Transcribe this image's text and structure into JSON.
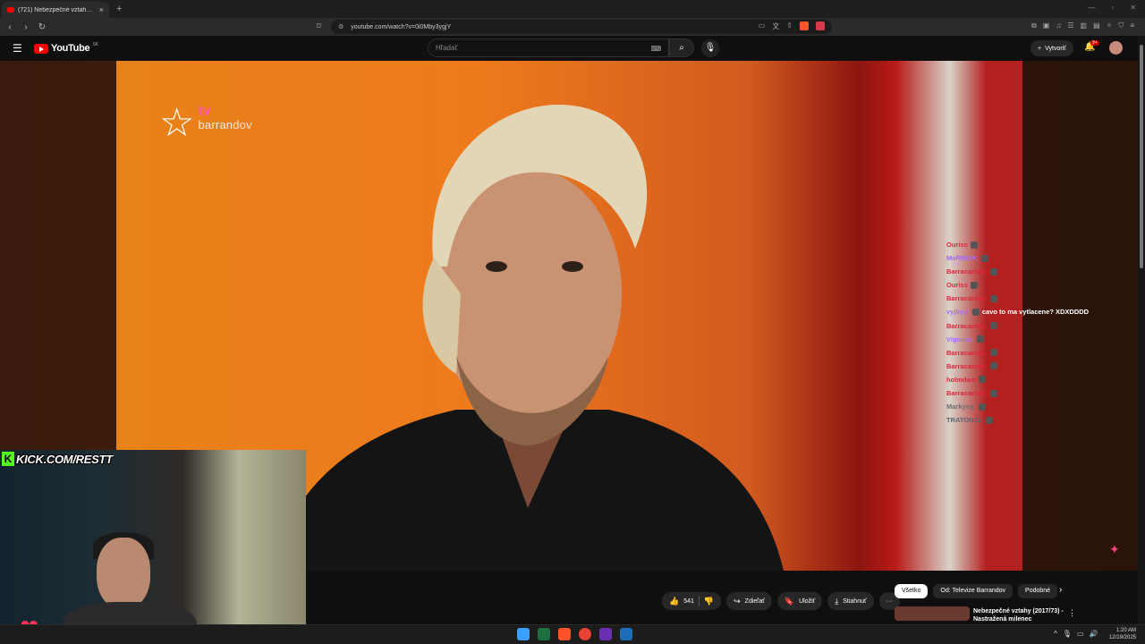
{
  "browser": {
    "tab_title": "(721) Nebezpečné vztahy (20",
    "tab_close": "×",
    "new_tab": "+",
    "url": "youtube.com/watch?v=0i0Mby3ygjY"
  },
  "youtube": {
    "logo_text": "YouTube",
    "country_code": "SK",
    "search_placeholder": "Hľadať",
    "create_label": "Vytvoriť",
    "notif_badge": "9+"
  },
  "video": {
    "channel_logo_tv": "tv",
    "channel_logo_brand": "barrandov",
    "overlay_url": "KICK.COM/RESTT"
  },
  "chat": [
    {
      "user": "Ouriss",
      "msg": "",
      "color": "#e0233a"
    },
    {
      "user": "MaRRIXX:",
      "msg": "",
      "color": "#a46bff"
    },
    {
      "user": "Barracanida:",
      "msg": "",
      "color": "#e0233a"
    },
    {
      "user": "Ouriss",
      "msg": "",
      "color": "#e0233a"
    },
    {
      "user": "Barracanida:",
      "msg": "",
      "color": "#e0233a"
    },
    {
      "user": "vyjbyy:",
      "msg": "cavo to ma vytlacene? XDXDDDD",
      "color": "#a46bff"
    },
    {
      "user": "Barracanida:",
      "msg": "",
      "color": "#e0233a"
    },
    {
      "user": "Vignnor:",
      "msg": "",
      "color": "#a46bff"
    },
    {
      "user": "Barracanida:",
      "msg": "",
      "color": "#e0233a"
    },
    {
      "user": "Barracanida:",
      "msg": "",
      "color": "#e0233a"
    },
    {
      "user": "holmdam",
      "msg": "",
      "color": "#e0233a"
    },
    {
      "user": "Barracanida:",
      "msg": "",
      "color": "#e0233a"
    },
    {
      "user": "Markyny:",
      "msg": "",
      "color": "#6c6c6c"
    },
    {
      "user": "TRATON11:",
      "msg": "",
      "color": "#5a6470"
    },
    {
      "user": "",
      "msg": "",
      "color": "#4a4a4a"
    },
    {
      "user": "",
      "msg": "",
      "color": "#3a3a3a"
    },
    {
      "user": "",
      "msg": "",
      "color": "#333"
    },
    {
      "user": "",
      "msg": "",
      "color": "#2d2d2d"
    }
  ],
  "actions": {
    "likes": "541",
    "share": "Zdieľať",
    "save": "Uložiť",
    "download": "Stiahnuť",
    "more": "···"
  },
  "chips": [
    "Všetko",
    "Od: Televize Barrandov",
    "Podobné"
  ],
  "recommendation": {
    "title": "Nebezpečné vztahy (2017/73) - Nastražená milenec",
    "more": "⋮"
  },
  "system": {
    "time": "1:20 AM",
    "date": "12/19/2025"
  },
  "colors": {
    "accent_red": "#ff0000",
    "kick_green": "#53fc18"
  }
}
